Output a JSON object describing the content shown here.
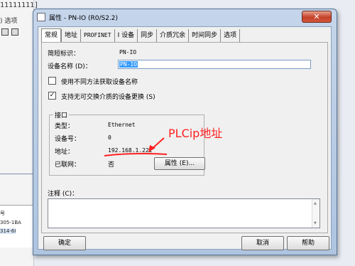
{
  "background": {
    "top_digits": "11111111]",
    "menu_fragment": ") 选项",
    "list_rows": [
      "号",
      "305-1BA",
      "314-6I"
    ]
  },
  "dialog": {
    "title": "属性 - PN-IO (R0/S2.2)",
    "close_glyph": "✕",
    "tabs": [
      "常规",
      "地址",
      "PROFINET",
      "I 设备",
      "同步",
      "介质冗余",
      "时间同步",
      "选项"
    ],
    "short_name_label": "简短标识：",
    "short_name_value": "PN-IO",
    "device_name_label": "设备名称 (D)：",
    "device_name_value": "PN-IO",
    "checkbox_different_method": {
      "label": "使用不同方法获取设备名称",
      "checked": false
    },
    "checkbox_device_replace": {
      "label": "支持无可交换介质的设备更换 (S)",
      "checked": true
    },
    "interface": {
      "group_title": "接口",
      "type_label": "类型：",
      "type_value": "Ethernet",
      "device_no_label": "设备号：",
      "device_no_value": "0",
      "address_label": "地址：",
      "address_value": "192.168.1.222",
      "networked_label": "已联网：",
      "networked_value": "否",
      "properties_button": "属性 (E)..."
    },
    "annotation": "PLCip地址",
    "annotation_color": "#ff2020",
    "notes_label": "注释 (C)：",
    "notes_value": "",
    "ok_button": "确定",
    "cancel_button": "取消",
    "help_button": "帮助"
  }
}
